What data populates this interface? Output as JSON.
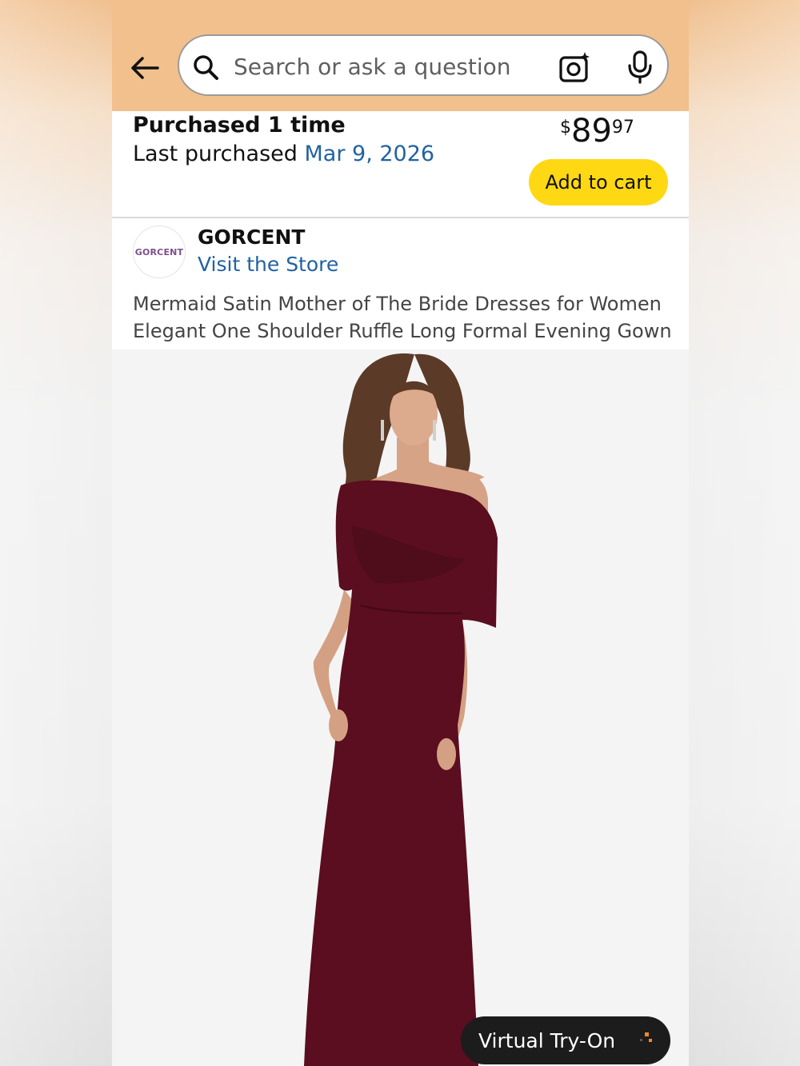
{
  "search": {
    "placeholder": "Search or ask a question"
  },
  "purchase": {
    "count_text": "Purchased 1 time",
    "last_label": "Last purchased",
    "last_date": "Mar 9, 2026",
    "price_currency": "$",
    "price_whole": "89",
    "price_fraction": "97",
    "add_to_cart": "Add to cart"
  },
  "store": {
    "logo_text": "GORCENT",
    "name": "GORCENT",
    "visit_label": "Visit the Store"
  },
  "product": {
    "title": "Mermaid Satin Mother of The Bride Dresses for Women Elegant One Shoulder Ruffle Long Formal Evening Gown",
    "dress_color": "#5a0e1f"
  },
  "virtual_try_on": {
    "label": "Virtual Try-On"
  },
  "colors": {
    "header_bg": "#f2c08d",
    "link": "#2162a1",
    "cart_button": "#ffd814"
  }
}
